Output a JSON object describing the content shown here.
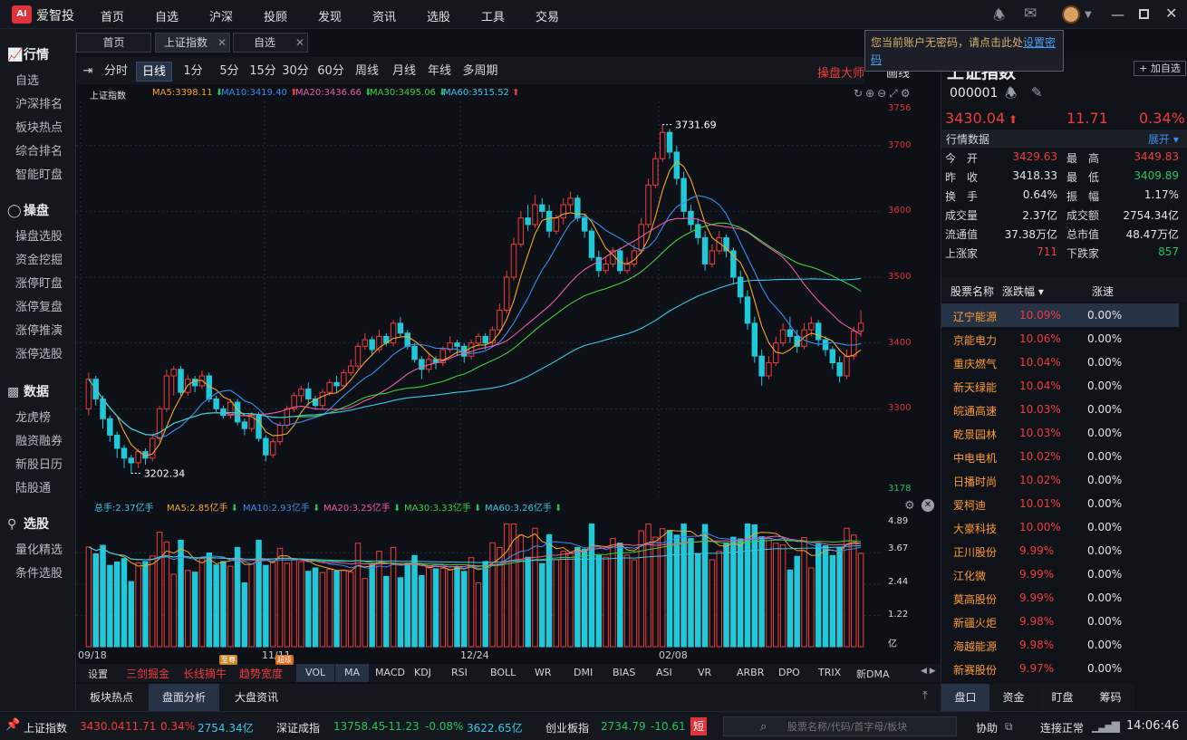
{
  "app": {
    "name": "爱智投",
    "nav": [
      "首页",
      "自选",
      "沪深",
      "投顾",
      "发现",
      "资讯",
      "选股",
      "工具",
      "交易"
    ]
  },
  "sidebar": {
    "sections": [
      {
        "title": "行情",
        "icon": "chart-icon",
        "items": [
          "自选",
          "沪深排名",
          "板块热点",
          "综合排名",
          "智能盯盘"
        ]
      },
      {
        "title": "操盘",
        "icon": "speedometer-icon",
        "items": [
          "操盘选股",
          "资金挖掘",
          "涨停盯盘",
          "涨停复盘",
          "涨停推演",
          "涨停选股"
        ]
      },
      {
        "title": "数据",
        "icon": "monitor-icon",
        "items": [
          "龙虎榜",
          "融资融券",
          "新股日历",
          "陆股通"
        ]
      },
      {
        "title": "选股",
        "icon": "search-icon",
        "items": [
          "量化精选",
          "条件选股"
        ]
      }
    ]
  },
  "tabs": [
    {
      "label": "首页",
      "closable": false
    },
    {
      "label": "上证指数",
      "closable": true
    },
    {
      "label": "自选",
      "closable": true
    }
  ],
  "periods": [
    "分时",
    "日线",
    "1分",
    "5分",
    "15分",
    "30分",
    "60分",
    "周线",
    "月线",
    "年线",
    "多周期"
  ],
  "active_period": "日线",
  "toolbar_right": {
    "btn1": "操盘大师",
    "btn2": "画线"
  },
  "tooltip": {
    "text": "您当前账户无密码，请点击此处",
    "link": "设置密码"
  },
  "chart_legend": {
    "name": "上证指数",
    "ma5": "MA5:3398.11",
    "ma10": "MA10:3419.40",
    "ma20": "MA20:3436.66",
    "ma30": "MA30:3495.06",
    "ma60": "MA60:3515.52"
  },
  "vol_legend": {
    "total": "总手:2.37亿手",
    "ma5": "MA5:2.85亿手",
    "ma10": "MA10:2.93亿手",
    "ma20": "MA20:3.25亿手",
    "ma30": "MA30:3.33亿手",
    "ma60": "MA60:3.26亿手"
  },
  "colors": {
    "up": "#f03c3c",
    "down": "#22c8d8",
    "ma5": "#f5a623",
    "ma10": "#3a8ef0",
    "ma20": "#ee5aa8",
    "ma30": "#3cd23c",
    "ma60": "#38c8e8"
  },
  "chart_data": {
    "type": "candlestick",
    "ylim": [
      3178,
      3756
    ],
    "y_ticks": [
      "3756",
      "3700",
      "3600",
      "3500",
      "3400",
      "3300",
      "3178"
    ],
    "x_labels": [
      "09/18",
      "11/11",
      "12/24",
      "02/08"
    ],
    "annotations": {
      "high": "3731.69",
      "low": "3202.34"
    },
    "candles": [
      [
        3300,
        3345,
        3355,
        3290
      ],
      [
        3345,
        3315,
        3350,
        3305
      ],
      [
        3315,
        3285,
        3320,
        3270
      ],
      [
        3285,
        3260,
        3290,
        3250
      ],
      [
        3260,
        3240,
        3265,
        3225
      ],
      [
        3240,
        3225,
        3245,
        3210
      ],
      [
        3225,
        3218,
        3230,
        3202
      ],
      [
        3218,
        3235,
        3240,
        3210
      ],
      [
        3235,
        3225,
        3240,
        3215
      ],
      [
        3225,
        3255,
        3260,
        3220
      ],
      [
        3255,
        3300,
        3305,
        3250
      ],
      [
        3300,
        3350,
        3360,
        3295
      ],
      [
        3350,
        3360,
        3365,
        3320
      ],
      [
        3360,
        3325,
        3365,
        3320
      ],
      [
        3325,
        3345,
        3352,
        3320
      ],
      [
        3345,
        3335,
        3350,
        3325
      ],
      [
        3335,
        3350,
        3358,
        3330
      ],
      [
        3350,
        3315,
        3355,
        3310
      ],
      [
        3315,
        3300,
        3320,
        3295
      ],
      [
        3300,
        3290,
        3305,
        3285
      ],
      [
        3290,
        3310,
        3315,
        3285
      ],
      [
        3310,
        3280,
        3315,
        3275
      ],
      [
        3280,
        3270,
        3285,
        3260
      ],
      [
        3270,
        3290,
        3295,
        3265
      ],
      [
        3290,
        3255,
        3295,
        3250
      ],
      [
        3255,
        3230,
        3260,
        3220
      ],
      [
        3230,
        3250,
        3255,
        3225
      ],
      [
        3250,
        3275,
        3280,
        3245
      ],
      [
        3275,
        3300,
        3305,
        3270
      ],
      [
        3300,
        3320,
        3325,
        3295
      ],
      [
        3320,
        3330,
        3335,
        3310
      ],
      [
        3330,
        3315,
        3340,
        3305
      ],
      [
        3315,
        3305,
        3320,
        3300
      ],
      [
        3305,
        3325,
        3330,
        3300
      ],
      [
        3325,
        3340,
        3345,
        3320
      ],
      [
        3340,
        3335,
        3350,
        3325
      ],
      [
        3335,
        3355,
        3360,
        3330
      ],
      [
        3355,
        3365,
        3375,
        3350
      ],
      [
        3365,
        3395,
        3400,
        3360
      ],
      [
        3395,
        3405,
        3415,
        3390
      ],
      [
        3405,
        3390,
        3410,
        3380
      ],
      [
        3390,
        3410,
        3420,
        3385
      ],
      [
        3410,
        3400,
        3415,
        3395
      ],
      [
        3400,
        3430,
        3435,
        3395
      ],
      [
        3430,
        3415,
        3440,
        3410
      ],
      [
        3415,
        3395,
        3420,
        3390
      ],
      [
        3395,
        3375,
        3400,
        3370
      ],
      [
        3375,
        3360,
        3380,
        3345
      ],
      [
        3360,
        3375,
        3385,
        3355
      ],
      [
        3375,
        3370,
        3380,
        3360
      ],
      [
        3370,
        3390,
        3395,
        3365
      ],
      [
        3390,
        3400,
        3410,
        3385
      ],
      [
        3400,
        3395,
        3405,
        3380
      ],
      [
        3395,
        3380,
        3400,
        3370
      ],
      [
        3380,
        3400,
        3405,
        3375
      ],
      [
        3400,
        3410,
        3415,
        3395
      ],
      [
        3410,
        3400,
        3415,
        3390
      ],
      [
        3400,
        3420,
        3425,
        3395
      ],
      [
        3420,
        3450,
        3460,
        3415
      ],
      [
        3450,
        3500,
        3510,
        3445
      ],
      [
        3500,
        3550,
        3560,
        3495
      ],
      [
        3550,
        3590,
        3600,
        3545
      ],
      [
        3590,
        3580,
        3610,
        3570
      ],
      [
        3580,
        3610,
        3625,
        3575
      ],
      [
        3610,
        3600,
        3620,
        3590
      ],
      [
        3600,
        3570,
        3610,
        3560
      ],
      [
        3570,
        3590,
        3595,
        3565
      ],
      [
        3590,
        3610,
        3620,
        3580
      ],
      [
        3610,
        3620,
        3630,
        3600
      ],
      [
        3620,
        3590,
        3625,
        3585
      ],
      [
        3590,
        3570,
        3595,
        3560
      ],
      [
        3570,
        3530,
        3575,
        3525
      ],
      [
        3530,
        3510,
        3540,
        3500
      ],
      [
        3510,
        3520,
        3530,
        3505
      ],
      [
        3520,
        3540,
        3545,
        3515
      ],
      [
        3540,
        3510,
        3545,
        3505
      ],
      [
        3510,
        3520,
        3530,
        3505
      ],
      [
        3520,
        3540,
        3550,
        3515
      ],
      [
        3540,
        3580,
        3590,
        3535
      ],
      [
        3580,
        3640,
        3650,
        3575
      ],
      [
        3640,
        3680,
        3690,
        3635
      ],
      [
        3680,
        3720,
        3731.69,
        3675
      ],
      [
        3720,
        3690,
        3725,
        3680
      ],
      [
        3690,
        3650,
        3700,
        3640
      ],
      [
        3650,
        3600,
        3660,
        3590
      ],
      [
        3600,
        3580,
        3610,
        3570
      ],
      [
        3580,
        3560,
        3590,
        3550
      ],
      [
        3560,
        3520,
        3570,
        3510
      ],
      [
        3520,
        3540,
        3550,
        3515
      ],
      [
        3540,
        3560,
        3570,
        3535
      ],
      [
        3560,
        3540,
        3565,
        3530
      ],
      [
        3540,
        3500,
        3545,
        3490
      ],
      [
        3500,
        3470,
        3510,
        3460
      ],
      [
        3470,
        3430,
        3480,
        3420
      ],
      [
        3430,
        3380,
        3440,
        3370
      ],
      [
        3380,
        3350,
        3390,
        3335
      ],
      [
        3350,
        3370,
        3380,
        3345
      ],
      [
        3370,
        3400,
        3410,
        3365
      ],
      [
        3400,
        3420,
        3430,
        3395
      ],
      [
        3420,
        3410,
        3440,
        3400
      ],
      [
        3410,
        3395,
        3420,
        3385
      ],
      [
        3395,
        3420,
        3430,
        3390
      ],
      [
        3420,
        3430,
        3440,
        3410
      ],
      [
        3430,
        3405,
        3435,
        3395
      ],
      [
        3405,
        3390,
        3410,
        3380
      ],
      [
        3390,
        3370,
        3395,
        3360
      ],
      [
        3370,
        3350,
        3380,
        3340
      ],
      [
        3350,
        3380,
        3390,
        3345
      ],
      [
        3380,
        3418,
        3425,
        3375
      ],
      [
        3418.33,
        3430.04,
        3449.83,
        3409.89
      ]
    ],
    "volume_ylim": [
      0,
      4.89
    ],
    "volume_ticks": [
      "4.89",
      "3.67",
      "2.44",
      "1.22",
      "亿"
    ]
  },
  "indicators": {
    "settings": "设置",
    "special": [
      "三剑掘金",
      "长线摘牛",
      "趋势宽度"
    ],
    "badges": [
      "至尊",
      "超级"
    ],
    "list": [
      "VOL",
      "MA",
      "MACD",
      "KDJ",
      "RSI",
      "BOLL",
      "WR",
      "DMI",
      "BIAS",
      "ASI",
      "VR",
      "ARBR",
      "DPO",
      "TRIX",
      "新DMA"
    ],
    "active": [
      "VOL",
      "MA"
    ]
  },
  "bottom_tabs": [
    "板块热点",
    "盘面分析",
    "大盘资讯"
  ],
  "bottom_tabs_active": "盘面分析",
  "right_panel": {
    "add_watch": "+ 加自选",
    "title": "上证指数",
    "code": "000001",
    "price": "3430.04",
    "change": "11.71",
    "change_pct": "0.34%",
    "market_data_label": "行情数据",
    "expand": "展开",
    "quotes": [
      {
        "l1": "今　开",
        "v1": "3429.63",
        "c1": "red",
        "l2": "最　高",
        "v2": "3449.83",
        "c2": "red"
      },
      {
        "l1": "昨　收",
        "v1": "3418.33",
        "c1": "white",
        "l2": "最　低",
        "v2": "3409.89",
        "c2": "green"
      },
      {
        "l1": "换　手",
        "v1": "0.64%",
        "c1": "white",
        "l2": "振　幅",
        "v2": "1.17%",
        "c2": "white"
      },
      {
        "l1": "成交量",
        "v1": "2.37亿",
        "c1": "white",
        "l2": "成交额",
        "v2": "2754.34亿",
        "c2": "white"
      },
      {
        "l1": "流通值",
        "v1": "37.38万亿",
        "c1": "white",
        "l2": "总市值",
        "v2": "48.47万亿",
        "c2": "white"
      },
      {
        "l1": "上涨家",
        "v1": "711",
        "c1": "red",
        "l2": "下跌家",
        "v2": "857",
        "c2": "green"
      }
    ],
    "list_headers": {
      "name": "股票名称",
      "sort": "涨跌幅",
      "speed": "涨速"
    },
    "stocks": [
      {
        "name": "辽宁能源",
        "pct": "10.09%",
        "speed": "0.00%"
      },
      {
        "name": "京能电力",
        "pct": "10.06%",
        "speed": "0.00%"
      },
      {
        "name": "重庆燃气",
        "pct": "10.04%",
        "speed": "0.00%"
      },
      {
        "name": "新天绿能",
        "pct": "10.04%",
        "speed": "0.00%"
      },
      {
        "name": "皖通高速",
        "pct": "10.03%",
        "speed": "0.00%"
      },
      {
        "name": "乾景园林",
        "pct": "10.03%",
        "speed": "0.00%"
      },
      {
        "name": "中电电机",
        "pct": "10.02%",
        "speed": "0.00%"
      },
      {
        "name": "日播时尚",
        "pct": "10.02%",
        "speed": "0.00%"
      },
      {
        "name": "爱柯迪",
        "pct": "10.01%",
        "speed": "0.00%"
      },
      {
        "name": "大豪科技",
        "pct": "10.00%",
        "speed": "0.00%"
      },
      {
        "name": "正川股份",
        "pct": "9.99%",
        "speed": "0.00%"
      },
      {
        "name": "江化微",
        "pct": "9.99%",
        "speed": "0.00%"
      },
      {
        "name": "莫高股份",
        "pct": "9.99%",
        "speed": "0.00%"
      },
      {
        "name": "新疆火炬",
        "pct": "9.98%",
        "speed": "0.00%"
      },
      {
        "name": "海越能源",
        "pct": "9.98%",
        "speed": "0.00%"
      },
      {
        "name": "新赛股份",
        "pct": "9.97%",
        "speed": "0.00%"
      }
    ],
    "tabs": [
      "盘口",
      "资金",
      "盯盘",
      "筹码"
    ],
    "tabs_active": "盘口"
  },
  "status": {
    "sh": {
      "name": "上证指数",
      "price": "3430.04",
      "chg": "11.71",
      "pct": "0.34%",
      "amt": "2754.34亿"
    },
    "sz": {
      "name": "深证成指",
      "price": "13758.45",
      "chg": "-11.23",
      "pct": "-0.08%",
      "amt": "3622.65亿"
    },
    "cy": {
      "name": "创业板指",
      "price": "2734.79",
      "chg": "-10.61"
    },
    "short": "短",
    "search_placeholder": "股票名称/代码/首字母/板块",
    "assist": "协助",
    "conn": "连接正常",
    "time": "14:06:46"
  }
}
